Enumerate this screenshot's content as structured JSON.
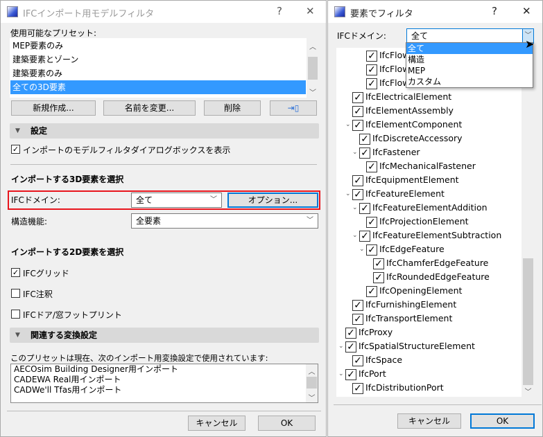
{
  "left": {
    "title": "IFCインポート用モデルフィルタ",
    "help": "?",
    "close": "✕",
    "presets_label": "使用可能なプリセット:",
    "presets": [
      "MEP要素のみ",
      "建築要素とゾーン",
      "建築要素のみ",
      "全ての3D要素"
    ],
    "new_btn": "新規作成...",
    "rename_btn": "名前を変更...",
    "delete_btn": "削除",
    "settings_header": "設定",
    "show_dialog_cb": "インポートのモデルフィルタダイアログボックスを表示",
    "section3d": "インポートする3D要素を選択",
    "ifc_domain_label": "IFCドメイン:",
    "ifc_domain_value": "全て",
    "options_btn": "オプション...",
    "struct_label": "構造機能:",
    "struct_value": "全要素",
    "section2d": "インポートする2D要素を選択",
    "cb_grid": "IFCグリッド",
    "cb_annot": "IFC注釈",
    "cb_door": "IFCドア/窓フットプリント",
    "related_header": "関連する変換設定",
    "related_desc": "このプリセットは現在、次のインポート用変換設定で使用されています:",
    "related": [
      "AECOsim Building Designer用インポート",
      "CADEWA Real用インポート",
      "CADWe'll Tfas用インポート"
    ],
    "cancel": "キャンセル",
    "ok": "OK"
  },
  "right": {
    "title": "要素でフィルタ",
    "help": "?",
    "close": "✕",
    "domain_label": "IFCドメイン:",
    "domain_value": "全て",
    "domain_options": [
      "全て",
      "構造",
      "MEP",
      "カスタム"
    ],
    "tree": [
      {
        "label": "IfcFlow",
        "level": 3
      },
      {
        "label": "IfcFlow",
        "level": 3
      },
      {
        "label": "IfcFlow",
        "level": 3
      },
      {
        "label": "IfcElectricalElement",
        "level": 1
      },
      {
        "label": "IfcElementAssembly",
        "level": 1
      },
      {
        "label": "IfcElementComponent",
        "level": 1,
        "expanded": true
      },
      {
        "label": "IfcDiscreteAccessory",
        "level": 2
      },
      {
        "label": "IfcFastener",
        "level": 2,
        "expanded": true
      },
      {
        "label": "IfcMechanicalFastener",
        "level": 3
      },
      {
        "label": "IfcEquipmentElement",
        "level": 1
      },
      {
        "label": "IfcFeatureElement",
        "level": 1,
        "expanded": true
      },
      {
        "label": "IfcFeatureElementAddition",
        "level": 2,
        "expanded": true
      },
      {
        "label": "IfcProjectionElement",
        "level": 3
      },
      {
        "label": "IfcFeatureElementSubtraction",
        "level": 2,
        "expanded": true
      },
      {
        "label": "IfcEdgeFeature",
        "level": 3,
        "expanded": true
      },
      {
        "label": "IfcChamferEdgeFeature",
        "level": 4
      },
      {
        "label": "IfcRoundedEdgeFeature",
        "level": 4
      },
      {
        "label": "IfcOpeningElement",
        "level": 3
      },
      {
        "label": "IfcFurnishingElement",
        "level": 1
      },
      {
        "label": "IfcTransportElement",
        "level": 1
      },
      {
        "label": "IfcProxy",
        "level": 0
      },
      {
        "label": "IfcSpatialStructureElement",
        "level": 0,
        "expanded": true
      },
      {
        "label": "IfcSpace",
        "level": 1
      },
      {
        "label": "IfcPort",
        "level": 0,
        "expanded": true
      },
      {
        "label": "IfcDistributionPort",
        "level": 1
      }
    ],
    "cancel": "キャンセル",
    "ok": "OK"
  }
}
